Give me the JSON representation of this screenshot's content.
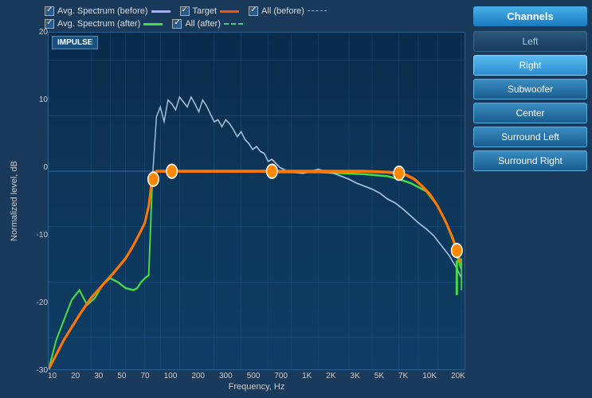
{
  "legend": {
    "items": [
      {
        "id": "avg-before",
        "label": "Avg. Spectrum (before)",
        "color": "#aaaaff",
        "checked": true,
        "dash": "solid"
      },
      {
        "id": "target",
        "label": "Target",
        "color": "#ff4444",
        "checked": true,
        "dash": "solid"
      },
      {
        "id": "all-before",
        "label": "All (before)",
        "color": "#cc88ff",
        "checked": true,
        "dash": "dashed"
      },
      {
        "id": "avg-after",
        "label": "Avg. Spectrum (after)",
        "color": "#44ff44",
        "checked": true,
        "dash": "solid"
      },
      {
        "id": "all-after",
        "label": "All (after)",
        "color": "#44cc88",
        "checked": true,
        "dash": "dashed"
      }
    ]
  },
  "yAxis": {
    "label": "Normalized level, dB",
    "ticks": [
      "20",
      "10",
      "0",
      "-10",
      "-20",
      "-30"
    ]
  },
  "xAxis": {
    "label": "Frequency, Hz",
    "ticks": [
      "10",
      "20",
      "30",
      "50",
      "70",
      "100",
      "200",
      "300",
      "500",
      "700",
      "1K",
      "2K",
      "3K",
      "5K",
      "7K",
      "10K",
      "20K"
    ]
  },
  "impulse_label": "IMPULSE",
  "sidebar": {
    "title": "Channels",
    "channels": [
      {
        "label": "Left",
        "state": "inactive"
      },
      {
        "label": "Right",
        "state": "active"
      },
      {
        "label": "Subwoofer",
        "state": "normal"
      },
      {
        "label": "Center",
        "state": "normal"
      },
      {
        "label": "Surround Left",
        "state": "normal"
      },
      {
        "label": "Surround Right",
        "state": "normal"
      }
    ]
  }
}
